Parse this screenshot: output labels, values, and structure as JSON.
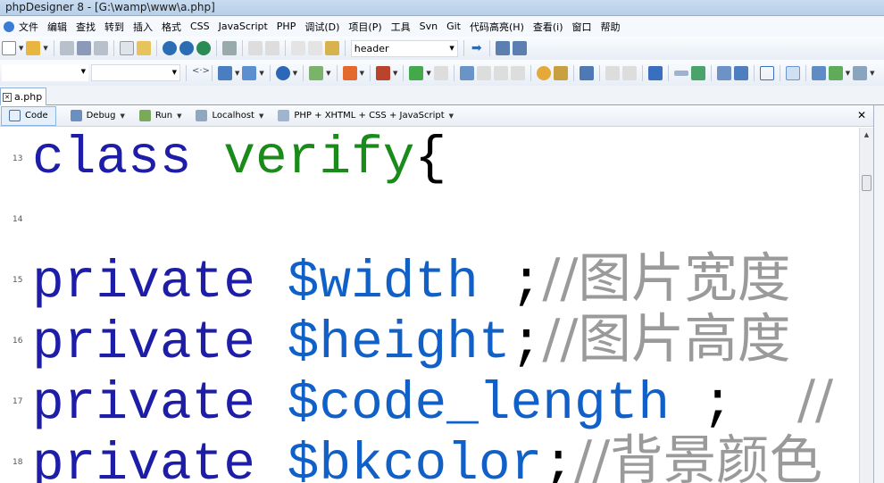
{
  "window": {
    "title": "phpDesigner 8 - [G:\\wamp\\www\\a.php]"
  },
  "menu": [
    "文件",
    "编辑",
    "查找",
    "转到",
    "插入",
    "格式",
    "CSS",
    "JavaScript",
    "PHP",
    "调试(D)",
    "项目(P)",
    "工具",
    "Svn",
    "Git",
    "代码高亮(H)",
    "查看(i)",
    "窗口",
    "帮助"
  ],
  "toolbar": {
    "search_value": "header"
  },
  "tabs": [
    {
      "label": "a.php"
    }
  ],
  "viewbar": {
    "code": "Code",
    "debug": "Debug",
    "run": "Run",
    "localhost": "Localhost",
    "language": "PHP + XHTML + CSS + JavaScript"
  },
  "editor": {
    "lines": [
      {
        "n": "13",
        "parts": [
          [
            "kw",
            "class "
          ],
          [
            "cls",
            "verify"
          ],
          [
            "pn",
            "{"
          ]
        ]
      },
      {
        "n": "14",
        "parts": []
      },
      {
        "n": "15",
        "parts": [
          [
            "kw",
            "private "
          ],
          [
            "var",
            "$width "
          ],
          [
            "pn",
            ";"
          ],
          [
            "cm",
            "//图片宽度"
          ]
        ]
      },
      {
        "n": "16",
        "parts": [
          [
            "kw",
            "private "
          ],
          [
            "var",
            "$height"
          ],
          [
            "pn",
            ";"
          ],
          [
            "cm",
            "//图片高度"
          ]
        ]
      },
      {
        "n": "17",
        "parts": [
          [
            "kw",
            "private "
          ],
          [
            "var",
            "$code_length "
          ],
          [
            "pn",
            ";  "
          ],
          [
            "cm",
            "//"
          ]
        ]
      },
      {
        "n": "18",
        "parts": [
          [
            "kw",
            "private "
          ],
          [
            "var",
            "$bkcolor"
          ],
          [
            "pn",
            ";"
          ],
          [
            "cm",
            "//背景颜色"
          ]
        ]
      }
    ]
  },
  "colors": {
    "keyword": "#1d1da8",
    "class_name": "#1a8a1a",
    "variable": "#1060c8",
    "comment": "#9a9a9a"
  }
}
